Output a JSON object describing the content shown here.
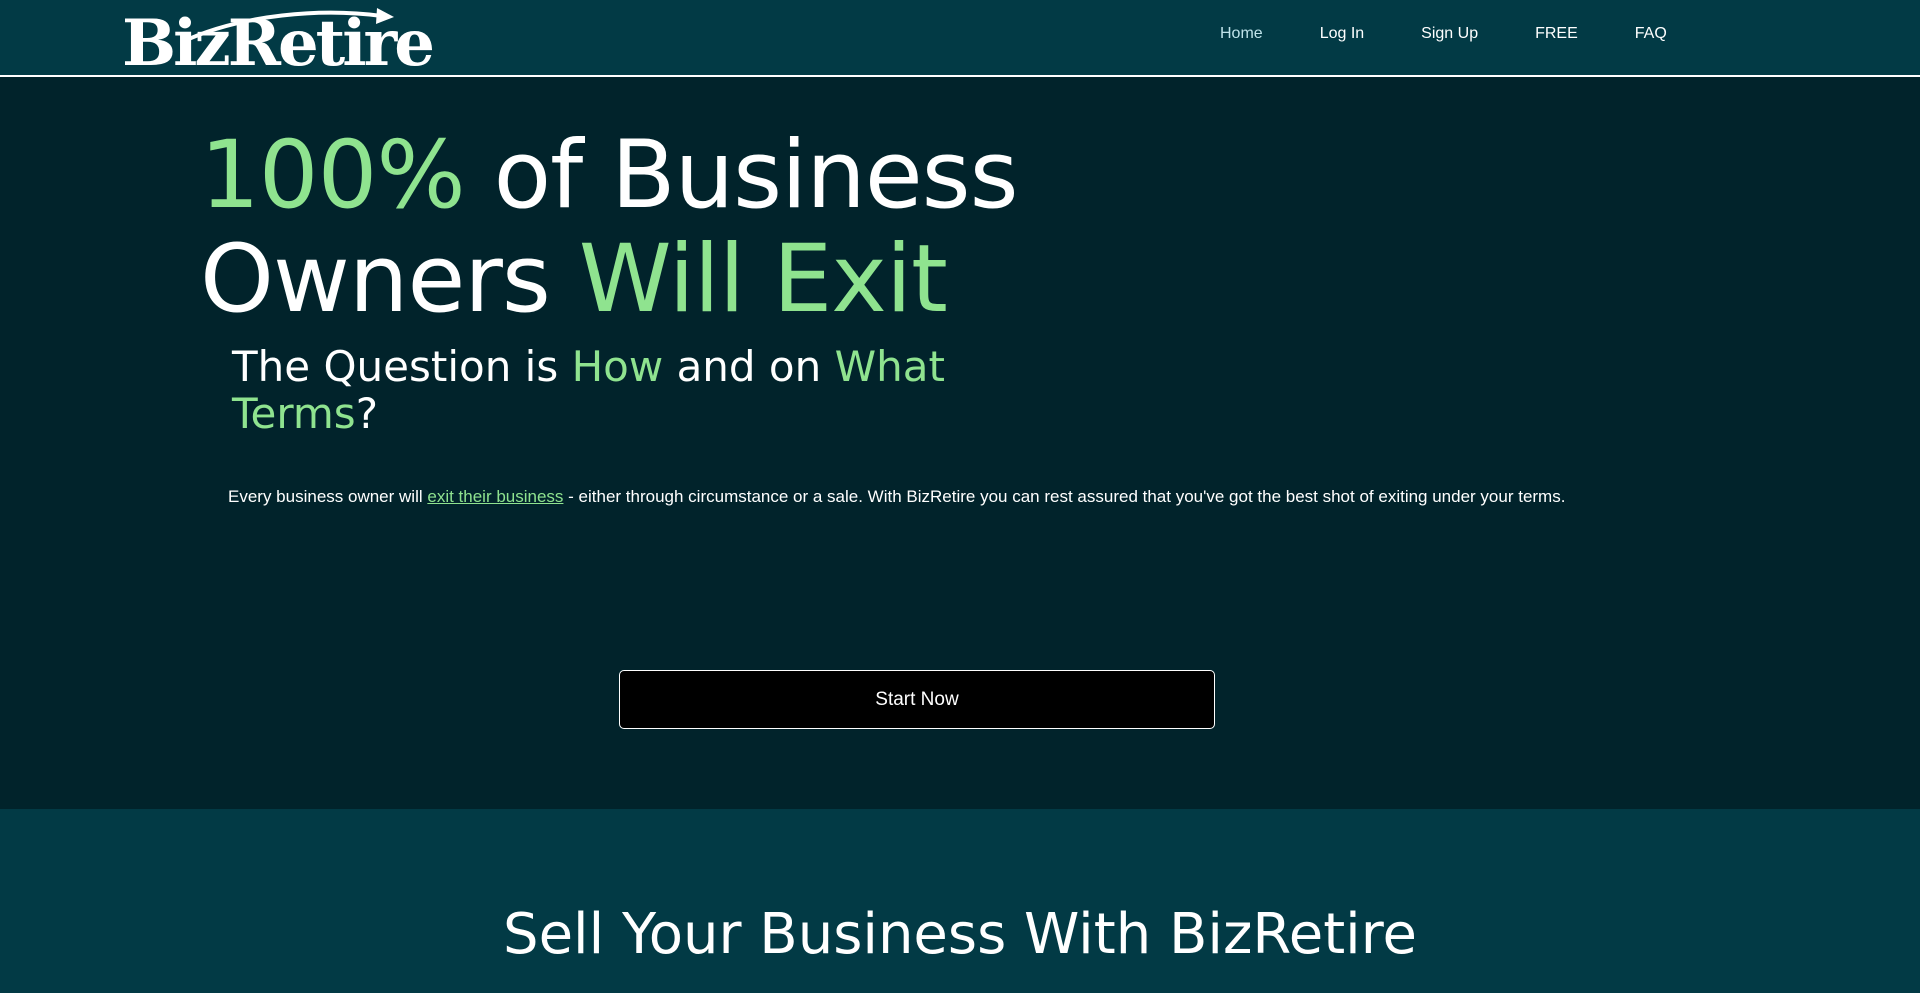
{
  "brand": {
    "logo_text": "BizRetire"
  },
  "nav": {
    "items": [
      {
        "label": "Home",
        "active": true
      },
      {
        "label": "Log In"
      },
      {
        "label": "Sign Up"
      },
      {
        "label": "FREE"
      },
      {
        "label": "FAQ"
      }
    ]
  },
  "hero": {
    "headline": {
      "part1": "100%",
      "part2": " of Business",
      "part3": "Owners ",
      "part4": "Will Exit"
    },
    "subhead": {
      "part1": "The Question is ",
      "part2": "How",
      "part3": " and on ",
      "part4": "What Terms",
      "part5": "?"
    },
    "body": {
      "before_link": "Every business owner will ",
      "link": "exit their business",
      "after_link": " - either through circumstance or a sale. With BizRetire you can rest assured that you've got the best shot of exiting under your terms."
    },
    "cta_label": "Start Now"
  },
  "section2": {
    "title": "Sell Your Business With BizRetire"
  },
  "colors": {
    "header_bg": "#023a45",
    "hero_bg": "#01232b",
    "accent_green": "#8fe38f",
    "button_bg": "#000000"
  }
}
